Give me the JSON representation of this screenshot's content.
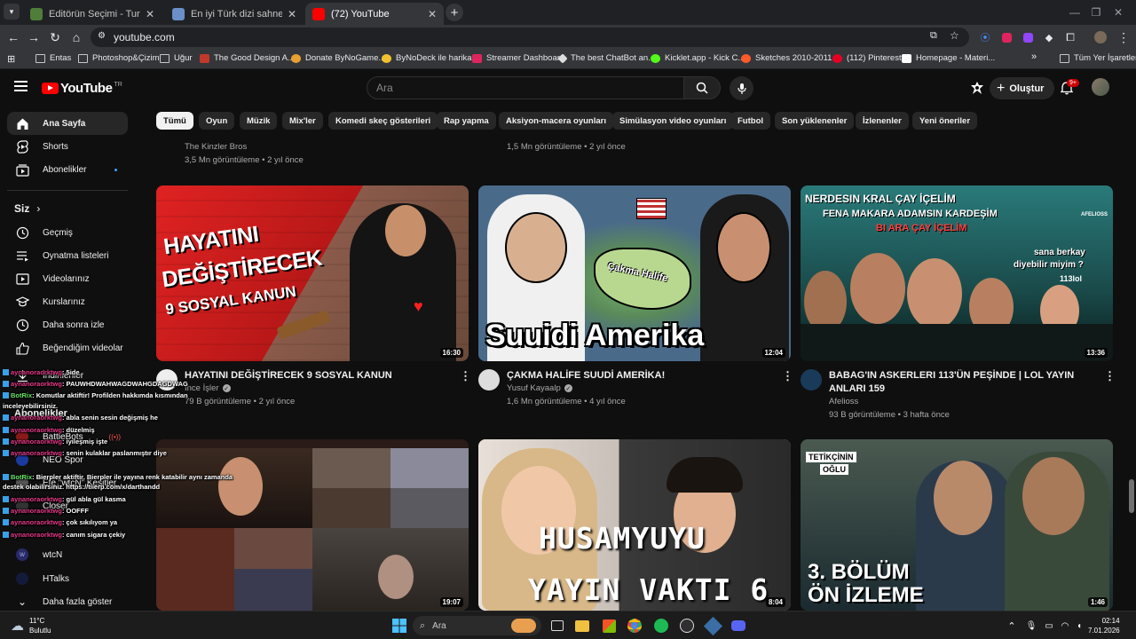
{
  "browser": {
    "tabs": [
      {
        "title": "Editörün Seçimi - Turnuva - Qu",
        "color": "#4f7d3a"
      },
      {
        "title": "En iyi Türk dizi sahnesi - Tier Li",
        "color": "#6a8fc9"
      },
      {
        "title": "(72) YouTube",
        "color": "#ff0000"
      }
    ],
    "new_tab": "+",
    "url": "youtube.com",
    "bookmarks": [
      {
        "label": "Entas",
        "icon": "folder-icon"
      },
      {
        "label": "Photoshop&Çizim",
        "icon": "folder-icon"
      },
      {
        "label": "Uğur",
        "icon": "folder-icon"
      },
      {
        "label": "The Good Design A...",
        "icon": "site-icon"
      },
      {
        "label": "Donate ByNoGame...",
        "icon": "site-icon"
      },
      {
        "label": "ByNoDeck ile harika...",
        "icon": "site-icon"
      },
      {
        "label": "Streamer Dashboard",
        "icon": "site-icon"
      },
      {
        "label": "The best ChatBot an...",
        "icon": "site-icon"
      },
      {
        "label": "Kicklet.app - Kick C...",
        "icon": "site-icon"
      },
      {
        "label": "Sketches 2010-2011...",
        "icon": "site-icon"
      },
      {
        "label": "(112) Pinterest",
        "icon": "site-icon"
      },
      {
        "label": "Homepage - Materi...",
        "icon": "site-icon"
      }
    ],
    "bookmarks_more": "»",
    "all_bookmarks": "Tüm Yer İşaretleri"
  },
  "header": {
    "logo_text": "YouTube",
    "logo_region": "TR",
    "search_placeholder": "Ara",
    "create_label": "Oluştur",
    "notification_count": "9+"
  },
  "sidebar": {
    "main": [
      {
        "label": "Ana Sayfa",
        "icon": "home-icon"
      },
      {
        "label": "Shorts",
        "icon": "shorts-icon"
      },
      {
        "label": "Abonelikler",
        "icon": "subscriptions-icon"
      }
    ],
    "you_heading": "Siz",
    "you": [
      {
        "label": "Geçmiş",
        "icon": "history-icon"
      },
      {
        "label": "Oynatma listeleri",
        "icon": "playlist-icon"
      },
      {
        "label": "Videolarınız",
        "icon": "your-videos-icon"
      },
      {
        "label": "Kurslarınız",
        "icon": "courses-icon"
      },
      {
        "label": "Daha sonra izle",
        "icon": "watch-later-icon"
      },
      {
        "label": "Beğendiğim videolar",
        "icon": "like-icon"
      },
      {
        "label": "İndirilenler",
        "icon": "download-icon"
      }
    ],
    "subs_heading": "Abonelikler",
    "subs": [
      {
        "label": "BattleBots"
      },
      {
        "label": "NEO Spor"
      },
      {
        "label": "Efe \"wtcN\" Kesitler"
      },
      {
        "label": "Closer"
      },
      {
        "label": "wtcN"
      },
      {
        "label": "HTalks"
      }
    ],
    "show_more": "Daha fazla göster"
  },
  "chips": [
    "Tümü",
    "Oyun",
    "Müzik",
    "Mix'ler",
    "Komedi skeç gösterileri",
    "Rap yapma",
    "Aksiyon-macera oyunları",
    "Simülasyon video oyunları",
    "Futbol",
    "Son yüklenenler",
    "İzlenenler",
    "Yeni öneriler"
  ],
  "prev_row": [
    {
      "channel": "The Kinzler Bros",
      "meta": "3,5 Mn görüntüleme • 2 yıl önce"
    },
    {
      "channel": "",
      "meta": "1,5 Mn görüntüleme • 2 yıl önce"
    }
  ],
  "videos": [
    {
      "title": "HAYATINI DEĞİŞTİRECEK 9 SOSYAL KANUN",
      "channel": "İnce İşler",
      "verified": true,
      "meta": "79 B görüntüleme • 2 yıl önce",
      "duration": "16:30",
      "thumb_text": [
        "HAYATINI",
        "DEĞİŞTİRECEK",
        "9 SOSYAL KANUN"
      ]
    },
    {
      "title": "ÇAKMA HALİFE SUUDİ AMERİKA!",
      "channel": "Yusuf Kayaalp",
      "verified": true,
      "meta": "1,6 Mn görüntüleme • 4 yıl önce",
      "duration": "12:04",
      "thumb_text": [
        "Suuidi Amerika",
        "Çakma Halife"
      ]
    },
    {
      "title": "BABAG'IN ASKERLERI 113'ÜN PEŞİNDE | LOL YAYIN ANLARI 159",
      "channel": "Afelioss",
      "verified": false,
      "meta": "93 B görüntüleme • 3 hafta önce",
      "duration": "13:36",
      "thumb_text": [
        "NERDESIN KRAL ÇAY İÇELİM",
        "FENA MAKARA ADAMSIN KARDEŞİM",
        "BI ARA ÇAY İÇELİM",
        "sana berkay",
        "diyebilir miyim ?",
        "113lol",
        "AFELIOSS"
      ]
    },
    {
      "duration": "19:07",
      "thumb_text": []
    },
    {
      "duration": "8:04",
      "thumb_text": [
        "HUSAMYUYU",
        "YAYIN VAKTI 6"
      ]
    },
    {
      "duration": "1:46",
      "thumb_text": [
        "TETİKÇİNİN",
        "OĞLU",
        "3. BÖLÜM",
        "ÖN İZLEME"
      ]
    }
  ],
  "chat": [
    {
      "user": "aynanoraorktwg",
      "msg": ": 5ide",
      "bot": false
    },
    {
      "user": "aynanoraorktwg",
      "msg": ": PAUWHDWAHWAGDWAHGDAGDWAG",
      "bot": false
    },
    {
      "user": "BotRix",
      "msg": ": Komutlar aktiftir! Profilden hakkımda kısmından",
      "bot": true
    },
    {
      "user": "",
      "msg": "inceleyebilirsiniz.",
      "bot": false
    },
    {
      "user": "aynanoraorktwg",
      "msg": ": abla senin sesin değişmiş he",
      "bot": false
    },
    {
      "user": "aynanoraorktwg",
      "msg": ": düzelmiş",
      "bot": false
    },
    {
      "user": "aynanoraorktwg",
      "msg": ": iyileşmiş işte",
      "bot": false
    },
    {
      "user": "aynanoraorktwg",
      "msg": ": senin kulaklar paslanmıştır diye",
      "bot": false
    },
    {
      "user": "BotRix",
      "msg": ": Bierpler aktiftir. Bierpler ile yayına renk katabilir aynı zamanda",
      "bot": true
    },
    {
      "user": "",
      "msg": "destek olabilirsiniz. https://tiierp.com/x/darthandd",
      "bot": false
    },
    {
      "user": "aynanoraorktwg",
      "msg": ": gül abla gül kasma",
      "bot": false
    },
    {
      "user": "aynanoraorktwg",
      "msg": ": OOFFF",
      "bot": false
    },
    {
      "user": "aynanoraorktwg",
      "msg": ": çok sıkılıyom ya",
      "bot": false
    },
    {
      "user": "aynanoraorktwg",
      "msg": ": canım sigara çekiy",
      "bot": false
    }
  ],
  "taskbar": {
    "weather_temp": "11°C",
    "weather_desc": "Bulutlu",
    "search_label": "Ara",
    "time": "02:14",
    "date": "7.01.2026"
  },
  "colors": {
    "accent": "#ff0000",
    "background": "#0f0f0f",
    "chip": "#272727",
    "link": "#3ea6ff"
  }
}
